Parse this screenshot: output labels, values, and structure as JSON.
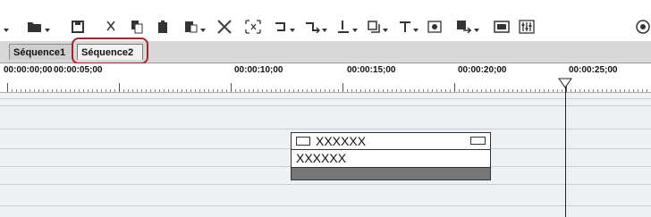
{
  "toolbar": {
    "icons": [
      "new-icon",
      "open-icon",
      "save-icon",
      "cut-icon",
      "copy-icon",
      "paste-icon",
      "paste-special-icon",
      "delete-icon",
      "replace-icon",
      "undo-icon",
      "redo-icon",
      "mark-icon",
      "clip-icon",
      "title-icon",
      "capture-icon",
      "export-icon",
      "monitor-icon",
      "mixer-icon",
      "settings-icon"
    ]
  },
  "tabs": [
    {
      "label": "Séquence1"
    },
    {
      "label": "Séquence2"
    }
  ],
  "ruler": {
    "timecodes": [
      "00:00:00;00",
      "00:00:05;00",
      "00:00:10;00",
      "00:00:15;00",
      "00:00:20;00",
      "00:00:25;00"
    ]
  },
  "clip": {
    "title": "XXXXXX",
    "subtitle": "XXXXXX"
  },
  "colors": {
    "highlight": "#a3252d",
    "track_bg": "#eef1f4",
    "tab_bar": "#d8d8d8"
  }
}
